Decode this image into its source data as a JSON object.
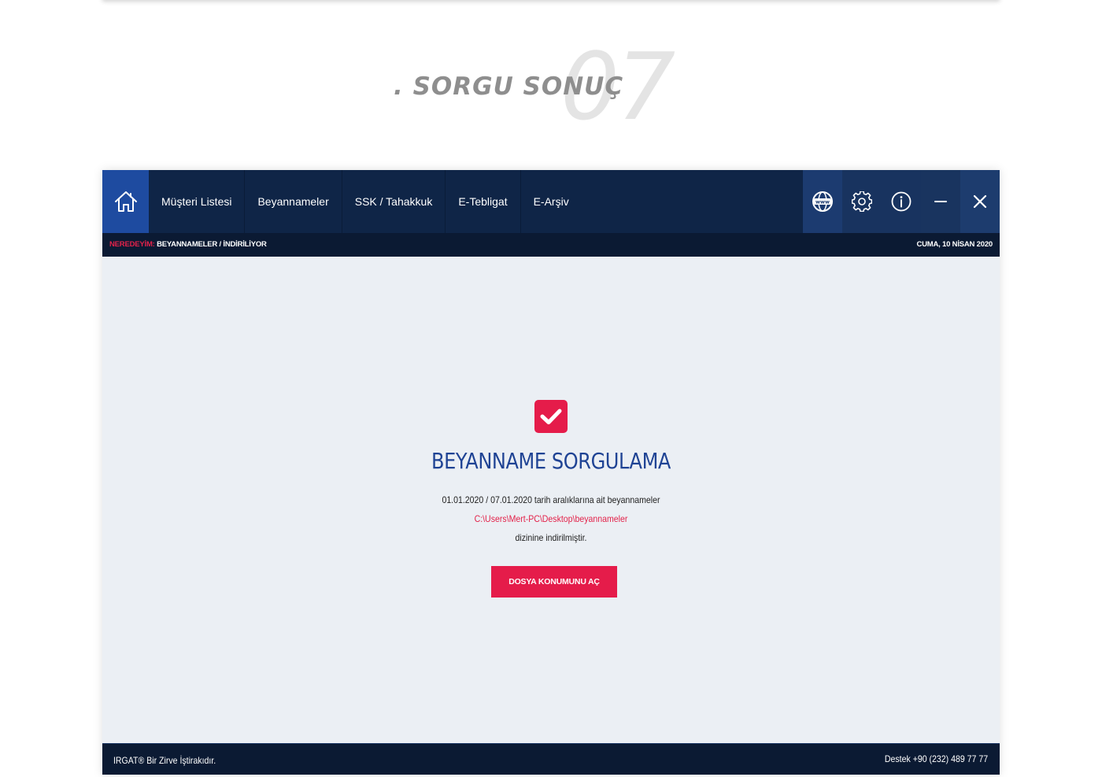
{
  "heading": {
    "number": "07",
    "title": ". SORGU SONUÇ"
  },
  "navbar": {
    "home_icon": "home-icon",
    "menu": [
      {
        "label": "Müşteri Listesi"
      },
      {
        "label": "Beyannameler"
      },
      {
        "label": "SSK / Tahakkuk"
      },
      {
        "label": "E-Tebligat"
      },
      {
        "label": "E-Arşiv"
      }
    ],
    "window_buttons": {
      "www_icon": "www-globe-icon",
      "www_text": "www",
      "settings_icon": "gear-icon",
      "info_icon": "info-icon",
      "minimize_icon": "minimize-icon",
      "close_icon": "close-icon"
    }
  },
  "breadcrumb": {
    "label": "NEREDEYİM:",
    "path": "BEYANNAMELER / İNDİRİLİYOR",
    "date": "CUMA, 10 NİSAN 2020"
  },
  "result": {
    "icon": "checkmark-icon",
    "title": "BEYANNAME SORGULAMA",
    "line1": "01.01.2020 / 07.01.2020 tarih aralıklarına ait beyannameler",
    "line2": "C:\\Users\\Mert-PC\\Desktop\\beyannameler",
    "line3": "dizinine indirilmiştir.",
    "button_label": "DOSYA KONUMUNU AÇ"
  },
  "footer": {
    "left": "IRGAT® Bir Zirve İştirakıdır.",
    "right": "Destek +90 (232) 489 77 77"
  },
  "colors": {
    "navbar": "#0f2547",
    "home_active": "#1e4ba0",
    "accent": "#e51c4a",
    "title_blue": "#1f4394",
    "content_bg": "#ebeff4"
  }
}
